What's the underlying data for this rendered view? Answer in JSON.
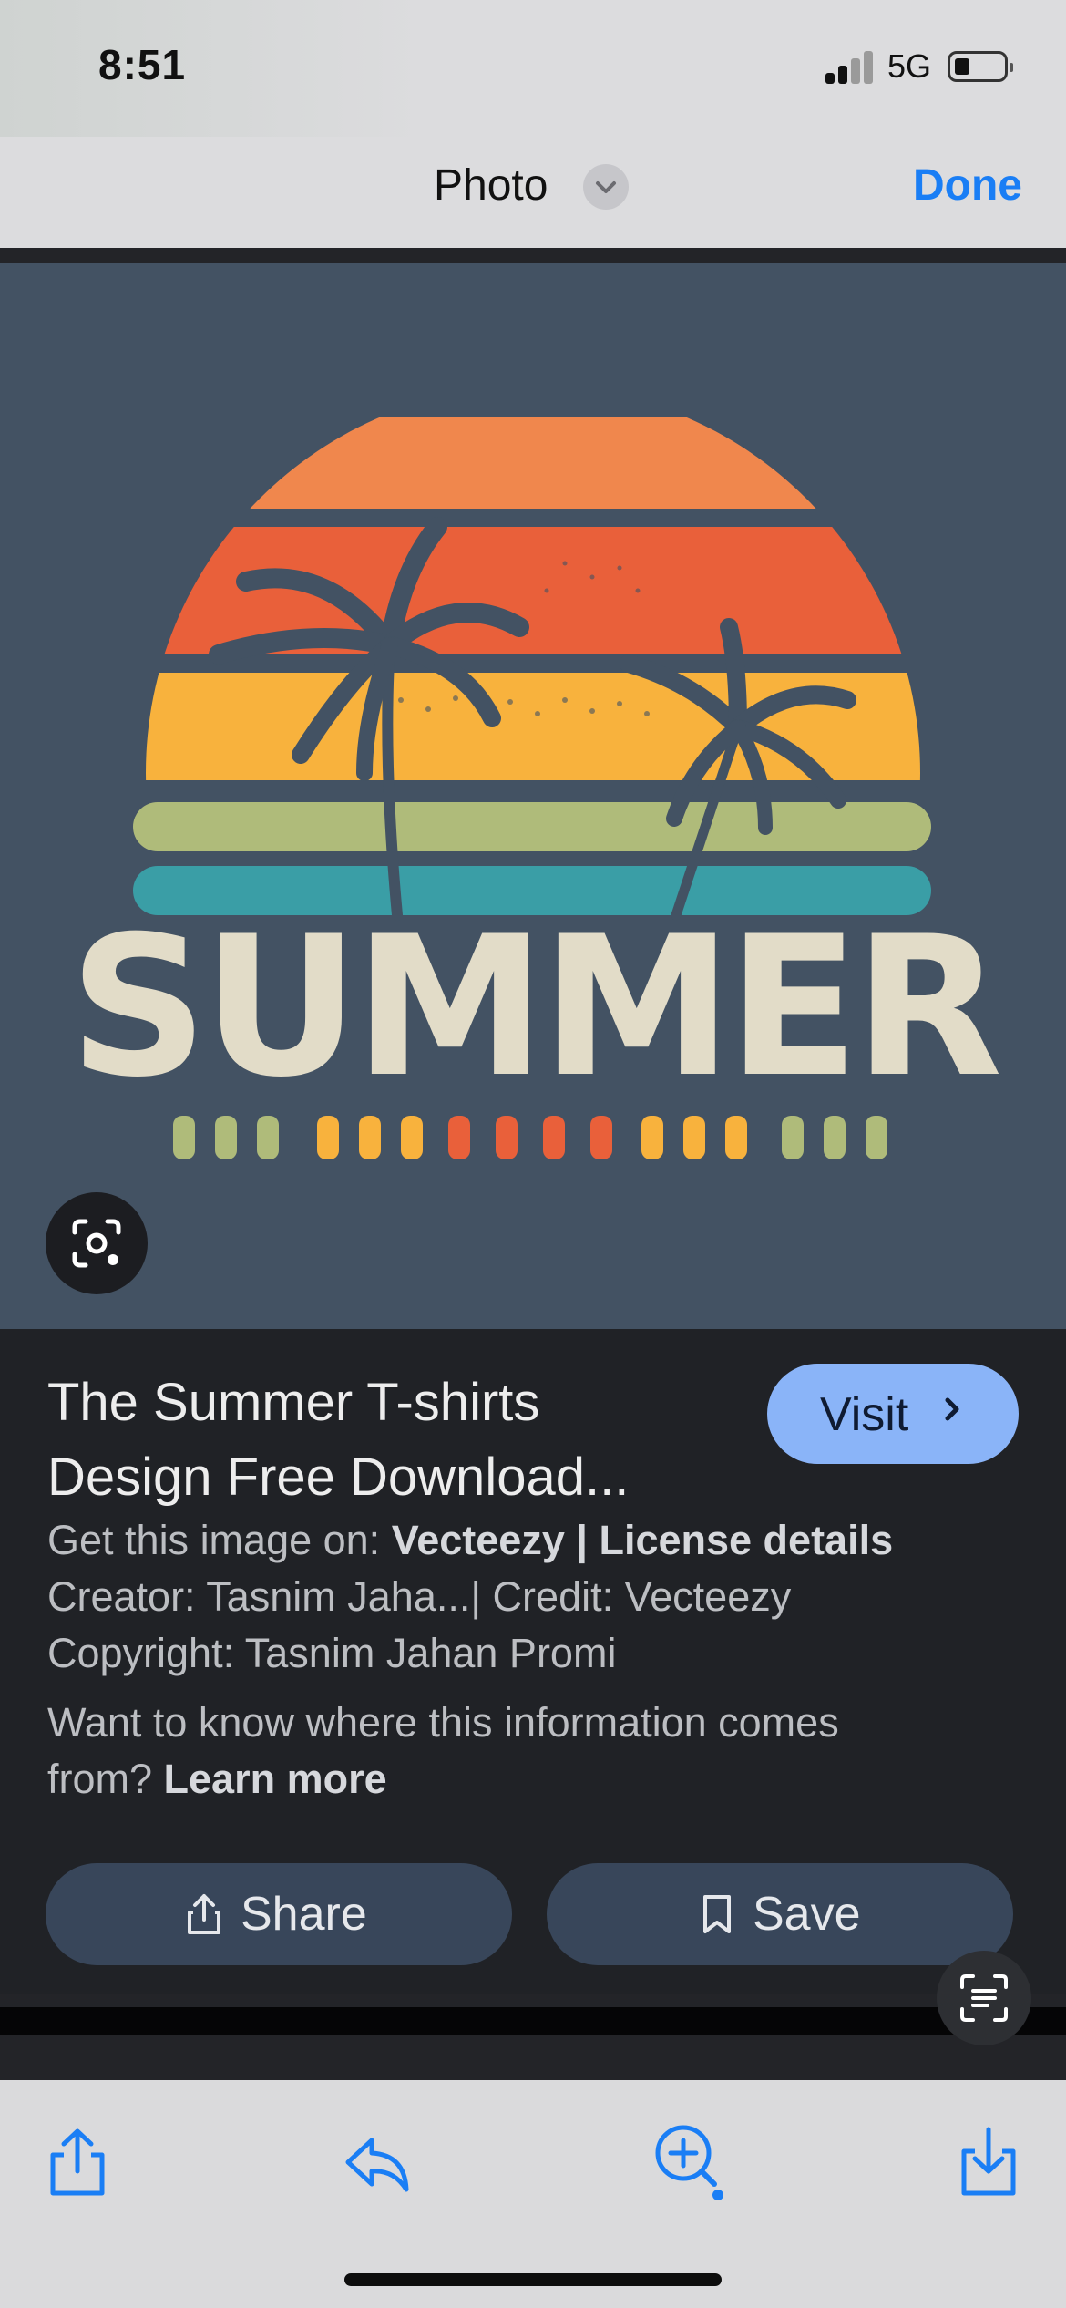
{
  "status": {
    "time": "8:51",
    "network": "5G"
  },
  "nav": {
    "title": "Photo",
    "done_label": "Done"
  },
  "image": {
    "text": "SUMMER",
    "colors": {
      "bg": "#435263",
      "sun_top": "#f0874d",
      "sun_red": "#e9603a",
      "sun_yellow": "#f8b23d",
      "stripe_green": "#afbb7a",
      "stripe_teal": "#3a9ea6",
      "text": "#e2dcc8"
    }
  },
  "info": {
    "title_line1": "The Summer T-shirts",
    "title_line2": "Design Free Download...",
    "visit_label": "Visit",
    "get_image_prefix": "Get this image on: ",
    "source": "Vecteezy",
    "separator": " | ",
    "license_link": "License details",
    "creator": "Creator: Tasnim Jaha...| Credit: Vecteezy",
    "copyright": "Copyright: Tasnim Jahan Promi",
    "want_know": "Want to know where this information comes",
    "from_prefix": "from? ",
    "learn_more": "Learn more",
    "share_label": "Share",
    "save_label": "Save"
  },
  "icons": {
    "lens": "lens-icon",
    "scan": "text-scan-icon",
    "share": "share-icon",
    "reply": "reply-icon",
    "zoom": "zoom-in-icon",
    "download": "download-icon"
  },
  "theme": {
    "accent": "#1a7ef5",
    "visit_bg": "#8ab4f8",
    "pill_bg": "#38465a",
    "panel_bg": "#202226"
  }
}
